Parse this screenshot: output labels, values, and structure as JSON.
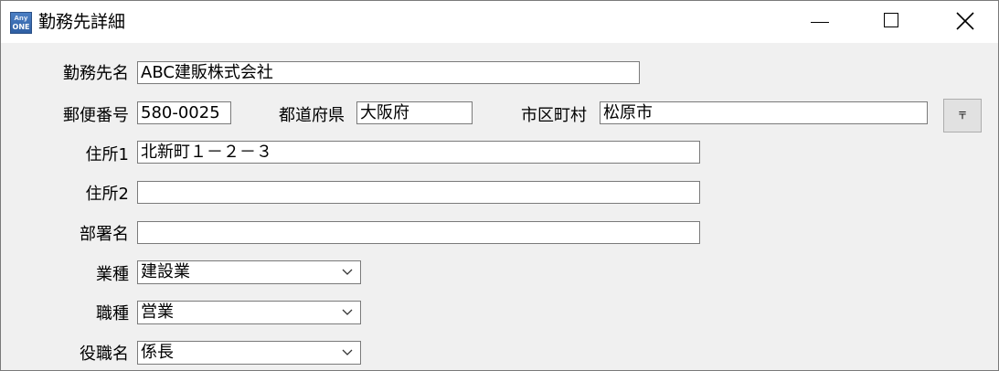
{
  "window": {
    "title": "勤務先詳細",
    "icon_top": "Any",
    "icon_bottom": "ONE"
  },
  "form": {
    "company_name": {
      "label": "勤務先名",
      "value": "ABC建販株式会社"
    },
    "postal_code": {
      "label": "郵便番号",
      "value": "580-0025"
    },
    "prefecture": {
      "label": "都道府県",
      "value": "大阪府"
    },
    "city": {
      "label": "市区町村",
      "value": "松原市"
    },
    "zip_lookup_button": {
      "label": "〒"
    },
    "address1": {
      "label": "住所1",
      "value": "北新町１－２－３"
    },
    "address2": {
      "label": "住所2",
      "value": ""
    },
    "department": {
      "label": "部署名",
      "value": ""
    },
    "industry": {
      "label": "業種",
      "value": "建設業"
    },
    "occupation": {
      "label": "職種",
      "value": "営業"
    },
    "position": {
      "label": "役職名",
      "value": "係長"
    }
  },
  "icons": {
    "minimize": "minimize-icon",
    "maximize": "maximize-icon",
    "close": "close-icon",
    "dropdown": "chevron-down-icon"
  }
}
